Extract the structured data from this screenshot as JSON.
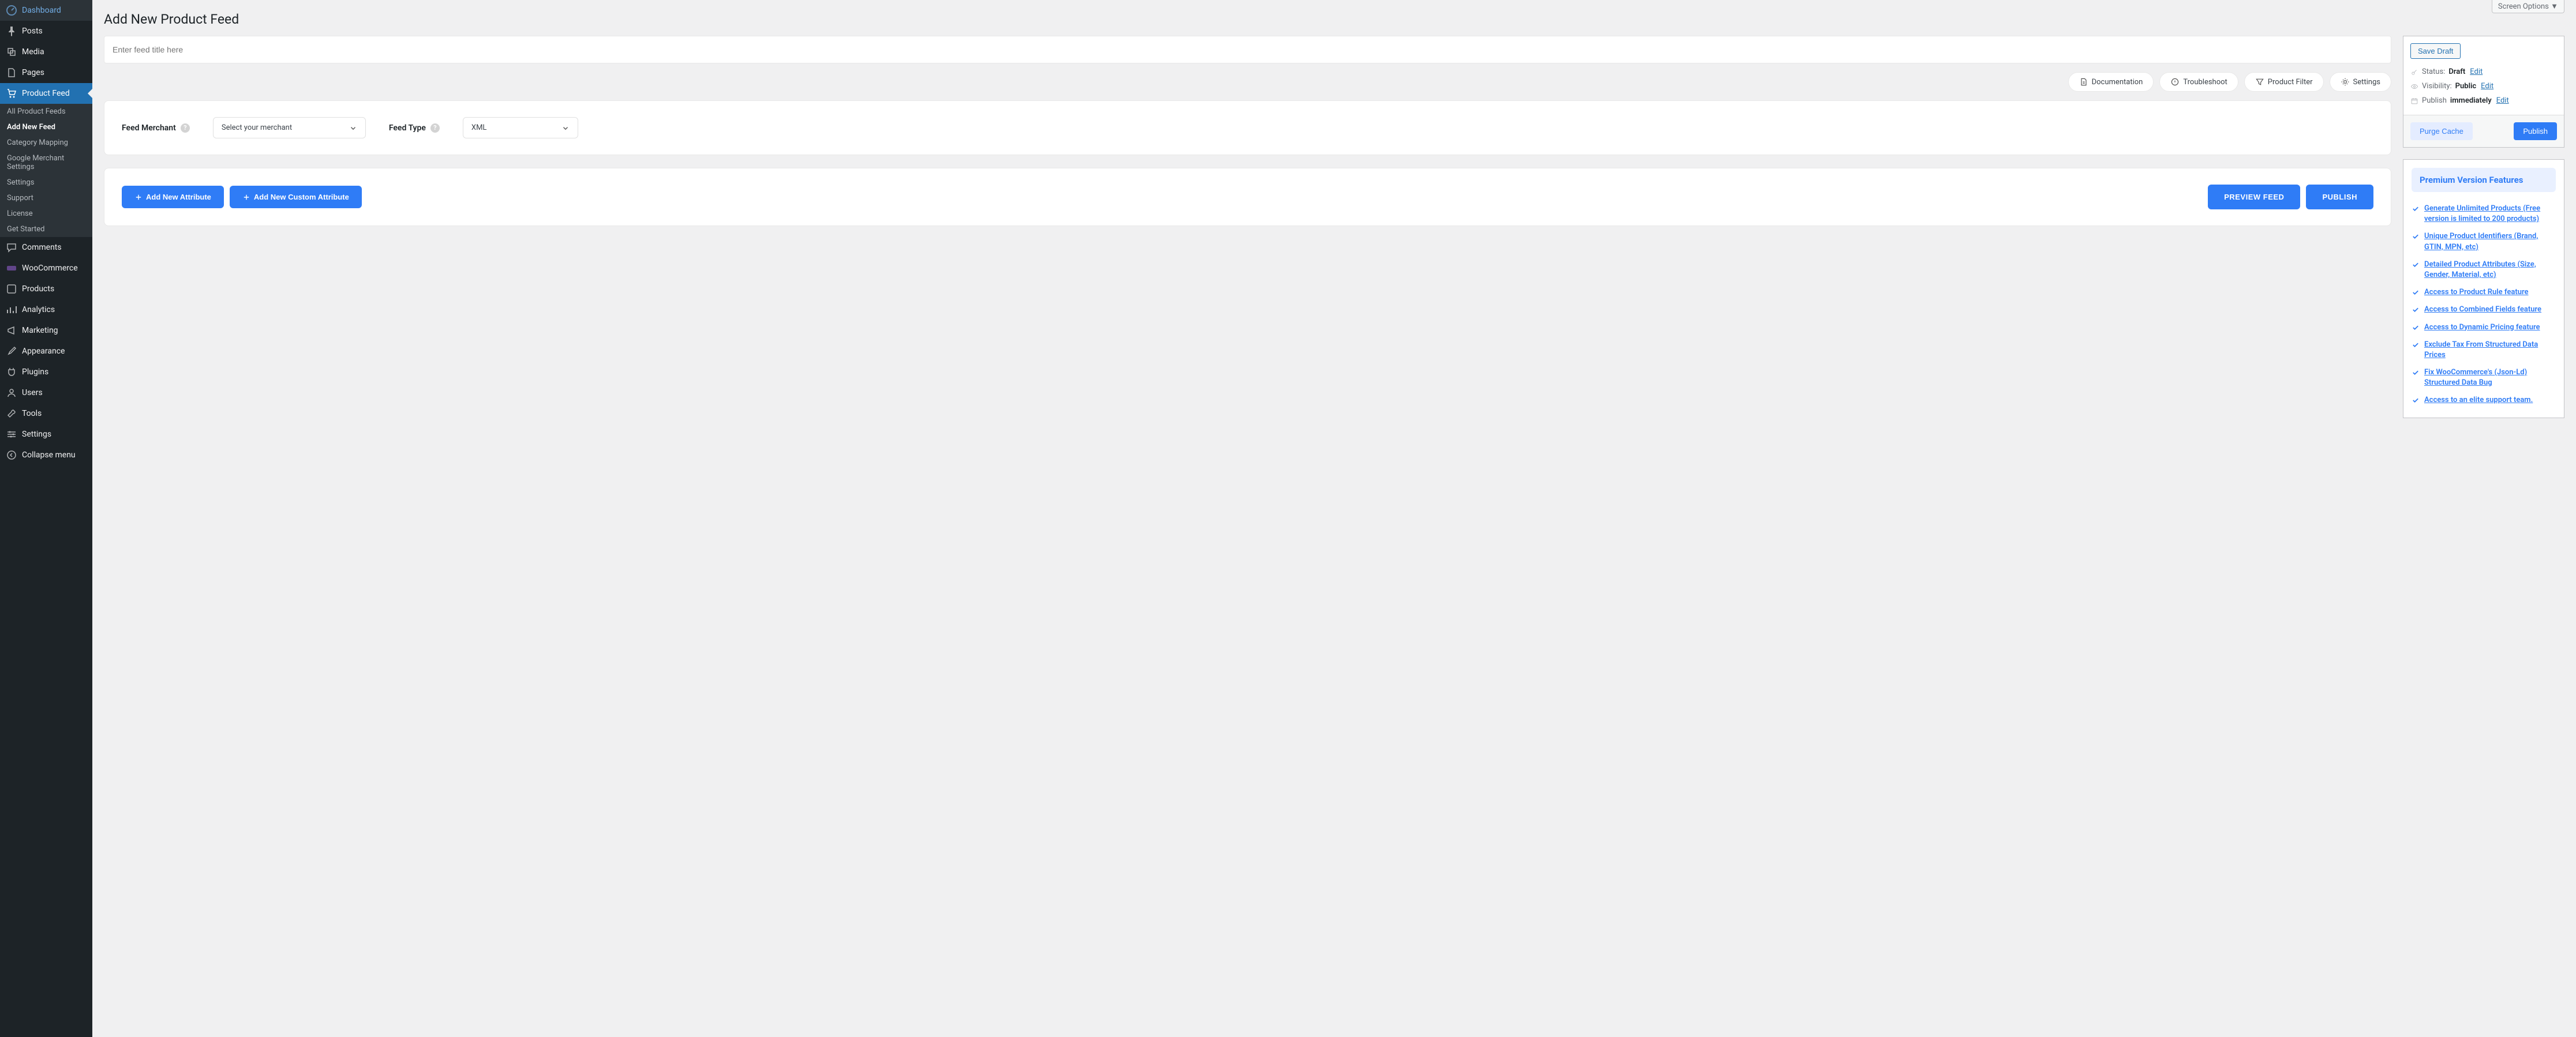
{
  "screen_options": "Screen Options",
  "page_title": "Add New Product Feed",
  "title_placeholder": "Enter feed title here",
  "sidebar": {
    "items": [
      {
        "label": "Dashboard"
      },
      {
        "label": "Posts"
      },
      {
        "label": "Media"
      },
      {
        "label": "Pages"
      },
      {
        "label": "Product Feed"
      },
      {
        "label": "Comments"
      },
      {
        "label": "WooCommerce"
      },
      {
        "label": "Products"
      },
      {
        "label": "Analytics"
      },
      {
        "label": "Marketing"
      },
      {
        "label": "Appearance"
      },
      {
        "label": "Plugins"
      },
      {
        "label": "Users"
      },
      {
        "label": "Tools"
      },
      {
        "label": "Settings"
      },
      {
        "label": "Collapse menu"
      }
    ],
    "submenu": [
      {
        "label": "All Product Feeds"
      },
      {
        "label": "Add New Feed"
      },
      {
        "label": "Category Mapping"
      },
      {
        "label": "Google Merchant Settings"
      },
      {
        "label": "Settings"
      },
      {
        "label": "Support"
      },
      {
        "label": "License"
      },
      {
        "label": "Get Started"
      }
    ]
  },
  "toolbar": {
    "documentation": "Documentation",
    "troubleshoot": "Troubleshoot",
    "product_filter": "Product Filter",
    "settings": "Settings"
  },
  "form": {
    "merchant_label": "Feed Merchant",
    "merchant_placeholder": "Select your merchant",
    "type_label": "Feed Type",
    "type_value": "XML"
  },
  "actions": {
    "add_attribute": "Add New Attribute",
    "add_custom": "Add New Custom Attribute",
    "preview": "PREVIEW FEED",
    "publish": "PUBLISH"
  },
  "publish_box": {
    "save_draft": "Save Draft",
    "status_label": "Status:",
    "status_value": "Draft",
    "visibility_label": "Visibility:",
    "visibility_value": "Public",
    "schedule_label": "Publish",
    "schedule_value": "immediately",
    "edit": "Edit",
    "purge": "Purge Cache",
    "publish": "Publish"
  },
  "premium": {
    "title": "Premium Version Features",
    "items": [
      "Generate Unlimited Products (Free version is limited to 200 products)",
      "Unique Product Identifiers (Brand, GTIN, MPN, etc)",
      "Detailed Product Attributes (Size, Gender, Material, etc)",
      "Access to Product Rule feature",
      "Access to Combined Fields feature",
      "Access to Dynamic Pricing feature",
      "Exclude Tax From Structured Data Prices",
      "Fix WooCommerce's (Json-Ld) Structured Data Bug",
      "Access to an elite support team."
    ]
  }
}
